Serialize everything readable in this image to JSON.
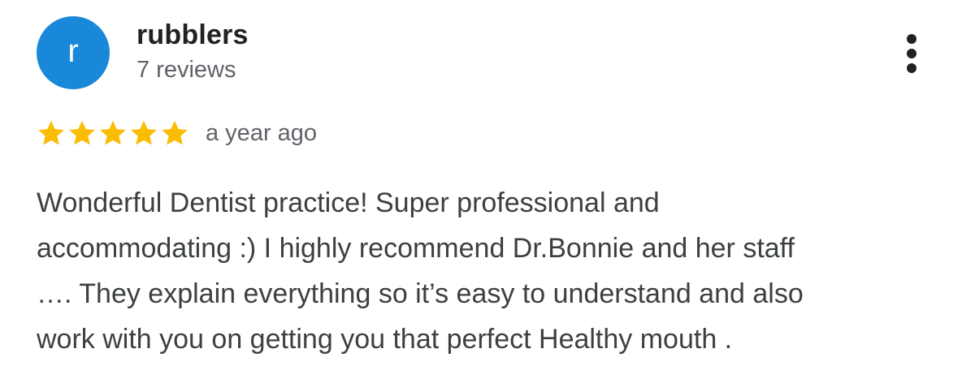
{
  "reviewer": {
    "avatar_letter": "r",
    "avatar_color": "#1a88d9",
    "name": "rubblers",
    "review_count": "7 reviews"
  },
  "review": {
    "rating": 5,
    "rating_max": 5,
    "star_color": "#fbbc04",
    "date": "a year ago",
    "text": "Wonderful Dentist practice! Super professional and\naccommodating :) I highly recommend Dr.Bonnie and her staff\n…. They explain everything so it’s easy to understand and also\nwork with you on getting you that perfect Healthy mouth ."
  },
  "actions": {
    "more_icon": "more-vert-icon"
  }
}
